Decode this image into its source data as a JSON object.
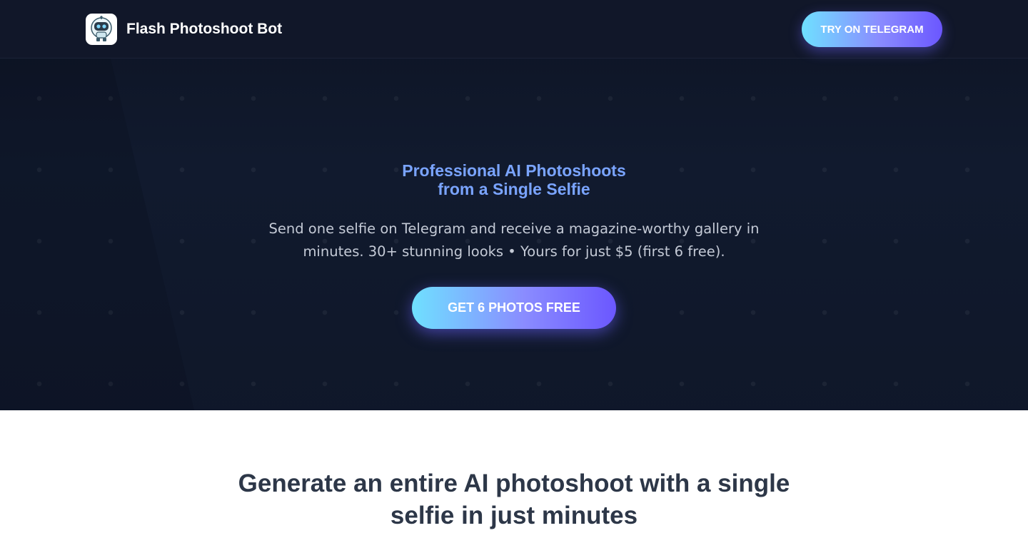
{
  "header": {
    "brand_name": "Flash Photoshoot Bot",
    "cta_label": "TRY ON TELEGRAM",
    "logo_icon": "robot-icon"
  },
  "hero": {
    "title_line1": "Professional AI Photoshoots",
    "title_line2": "from a Single Selfie",
    "subtitle_line1": "Send one selfie on Telegram and receive a magazine-worthy gallery in",
    "subtitle_line2": "minutes. 30+ stunning looks • Yours for just $5 (first 6 free).",
    "cta_label": "GET 6 PHOTOS FREE"
  },
  "section": {
    "heading_line1": "Generate an entire AI photoshoot with a single",
    "heading_line2": "selfie in just minutes"
  },
  "colors": {
    "header_bg": "#111729",
    "hero_bg": "#111a2e",
    "accent_gradient_start": "#6fe0ff",
    "accent_gradient_end": "#6b57ff",
    "hero_title": "#7aa4ff",
    "section_heading": "#2d3748"
  }
}
